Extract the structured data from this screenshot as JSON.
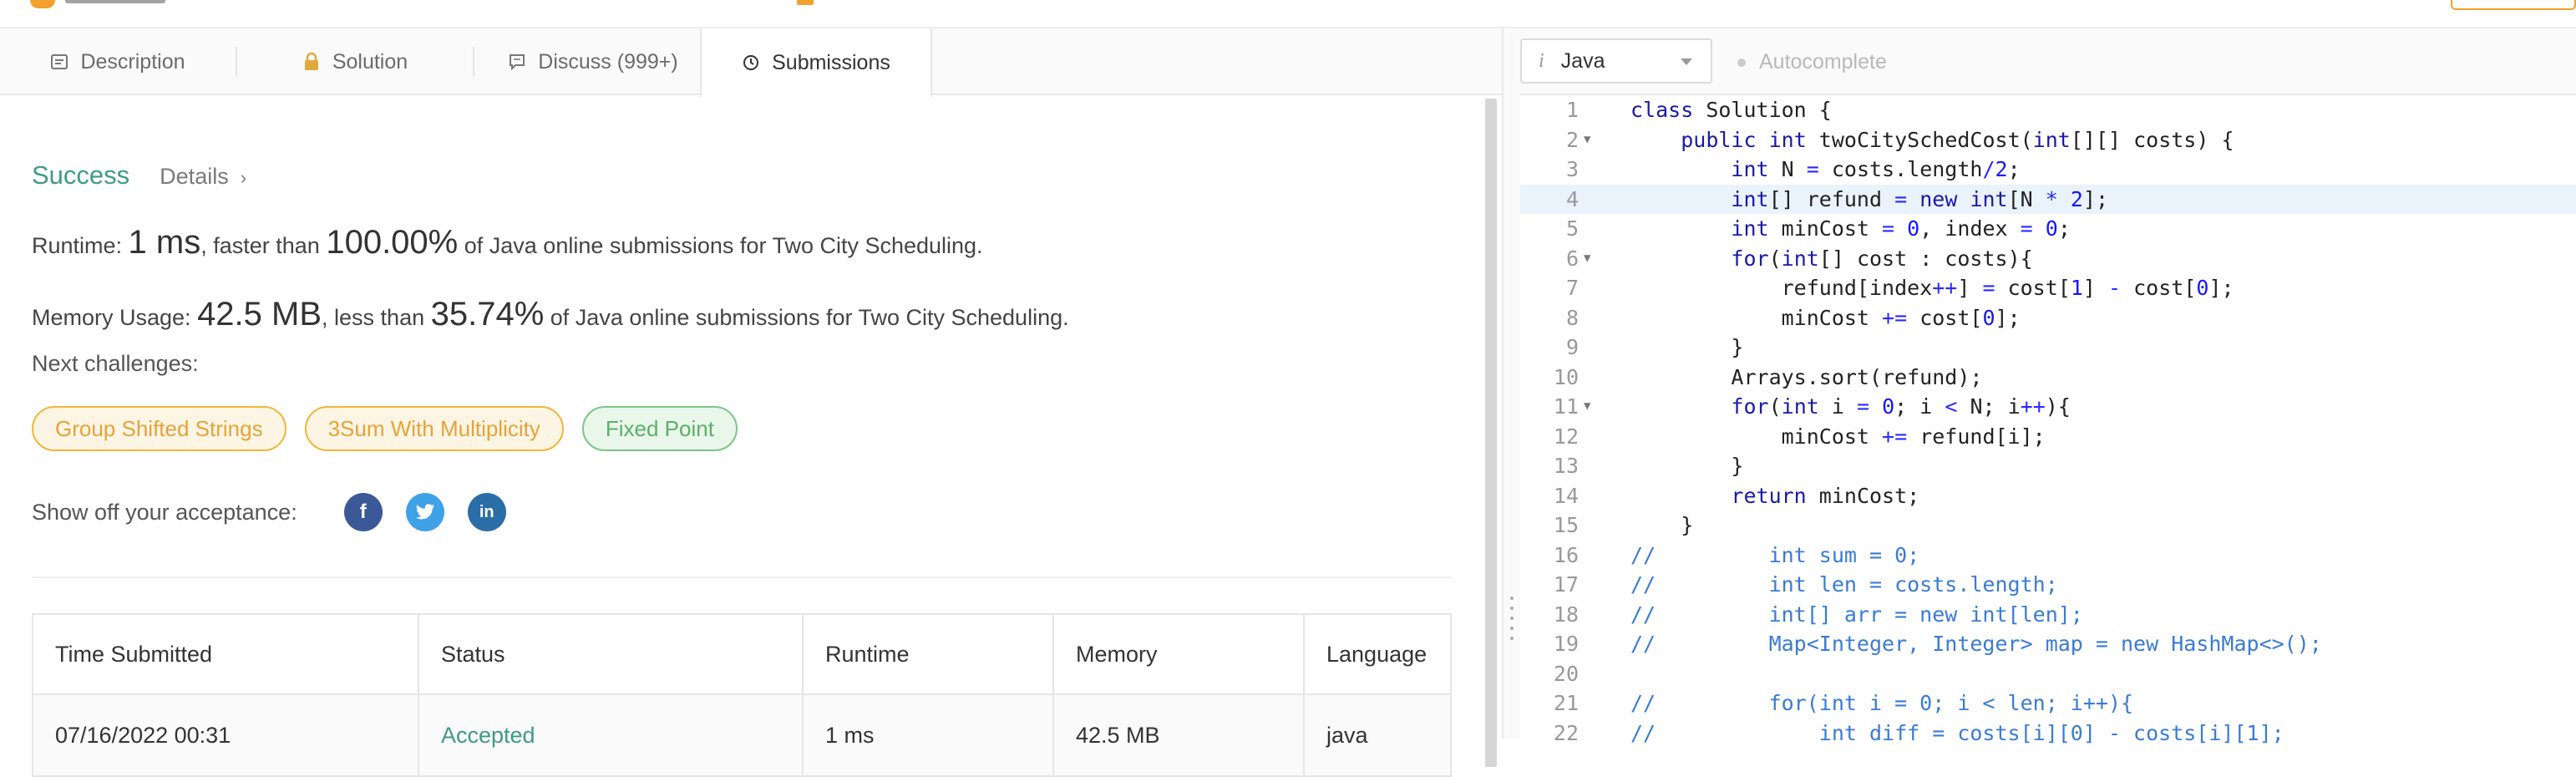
{
  "tabs": {
    "description": "Description",
    "solution": "Solution",
    "discuss": "Discuss (999+)",
    "submissions": "Submissions"
  },
  "result": {
    "status": "Success",
    "details": "Details",
    "runtime_label": "Runtime: ",
    "runtime_value": "1 ms",
    "runtime_mid": ", faster than ",
    "runtime_pct": "100.00%",
    "runtime_tail": " of Java online submissions for Two City Scheduling.",
    "memory_label": "Memory Usage: ",
    "memory_value": "42.5 MB",
    "memory_mid": ", less than ",
    "memory_pct": "35.74%",
    "memory_tail": " of Java online submissions for Two City Scheduling."
  },
  "challenges": {
    "label": "Next challenges:",
    "items": [
      {
        "name": "Group Shifted Strings",
        "difficulty": "medium"
      },
      {
        "name": "3Sum With Multiplicity",
        "difficulty": "medium"
      },
      {
        "name": "Fixed Point",
        "difficulty": "easy"
      }
    ]
  },
  "share": {
    "label": "Show off your acceptance:",
    "facebook": "f",
    "twitter": "t",
    "linkedin": "in"
  },
  "table": {
    "headers": [
      "Time Submitted",
      "Status",
      "Runtime",
      "Memory",
      "Language"
    ],
    "rows": [
      [
        "07/16/2022 00:31",
        "Accepted",
        "1 ms",
        "42.5 MB",
        "java"
      ]
    ]
  },
  "editor": {
    "language": "Java",
    "language_icon": "i",
    "autocomplete": "Autocomplete",
    "highlighted_line": 4,
    "lines": [
      "class Solution {",
      "    public int twoCitySchedCost(int[][] costs) {",
      "        int N = costs.length/2;",
      "        int[] refund = new int[N * 2];",
      "        int minCost = 0, index = 0;",
      "        for(int[] cost : costs){",
      "            refund[index++] = cost[1] - cost[0];",
      "            minCost += cost[0];",
      "        }",
      "        Arrays.sort(refund);",
      "        for(int i = 0; i < N; i++){",
      "            minCost += refund[i];",
      "        }",
      "        return minCost;",
      "    }",
      "//         int sum = 0;",
      "//         int len = costs.length;",
      "//         int[] arr = new int[len];",
      "//         Map<Integer, Integer> map = new HashMap<>();",
      "",
      "//         for(int i = 0; i < len; i++){",
      "//             int diff = costs[i][0] - costs[i][1];"
    ],
    "fold_lines": [
      2,
      6,
      11
    ]
  },
  "colors": {
    "success": "#3f9c7d",
    "medium": "#e6a23c",
    "easy": "#5daf6b",
    "line_highlight": "#eaf2fb"
  }
}
